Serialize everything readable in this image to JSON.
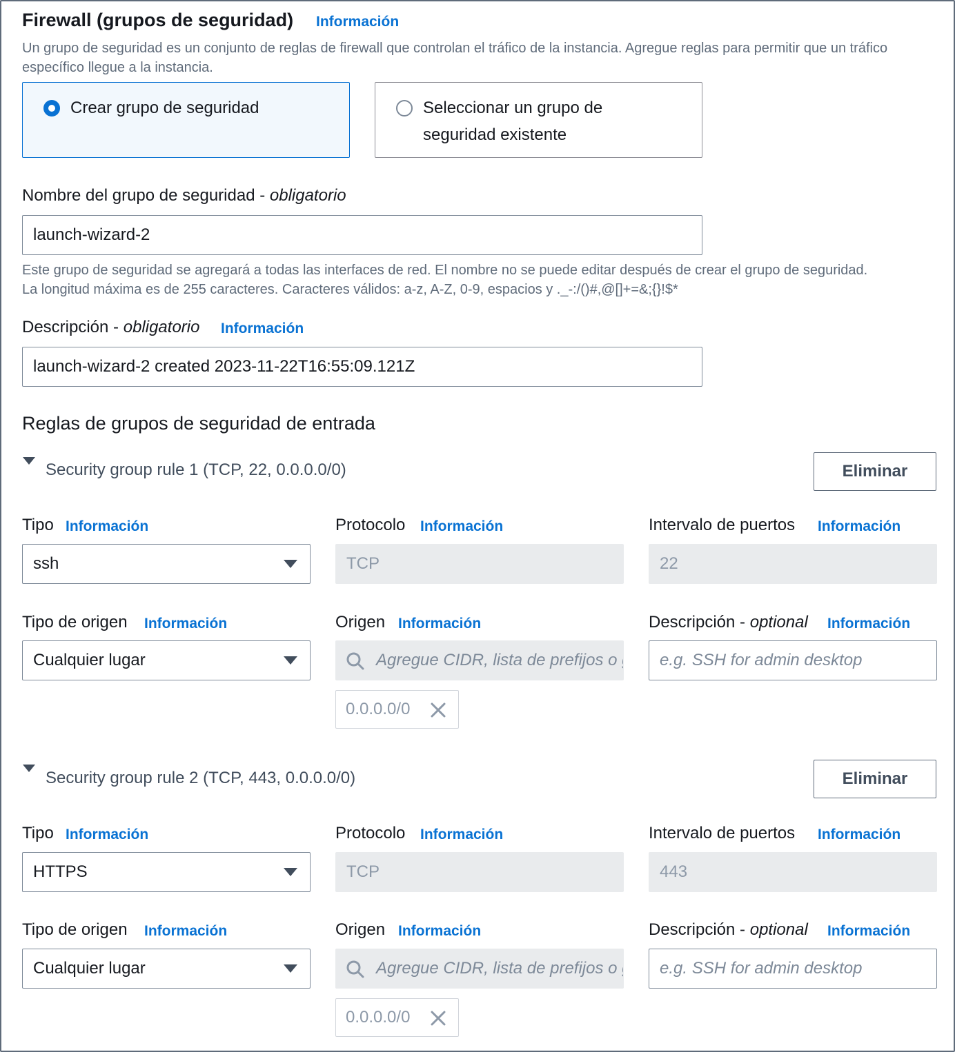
{
  "firewall": {
    "title": "Firewall (grupos de seguridad)",
    "info": "Información",
    "description": "Un grupo de seguridad es un conjunto de reglas de firewall que controlan el tráfico de la instancia. Agregue reglas para permitir que un tráfico específico llegue a la instancia.",
    "options": [
      {
        "label": "Crear grupo de seguridad",
        "selected": true
      },
      {
        "label_line1": "Seleccionar un grupo de",
        "label_line2": "seguridad existente",
        "selected": false
      }
    ]
  },
  "group_name": {
    "label": "Nombre del grupo de seguridad - ",
    "required": "obligatorio",
    "value": "launch-wizard-2",
    "help_line1": "Este grupo de seguridad se agregará a todas las interfaces de red. El nombre no se puede editar después de crear el grupo de seguridad.",
    "help_line2": "La longitud máxima es de 255 caracteres. Caracteres válidos: a-z, A-Z, 0-9, espacios y ._-:/()#,@[]+=&;{}!$*"
  },
  "group_description": {
    "label": "Descripción - ",
    "required": "obligatorio",
    "info": "Información",
    "value": "launch-wizard-2 created 2023-11-22T16:55:09.121Z"
  },
  "inbound": {
    "title": "Reglas de grupos de seguridad de entrada",
    "info_label": "Información",
    "delete_label": "Eliminar",
    "labels": {
      "type": "Tipo",
      "protocol": "Protocolo",
      "port_range": "Intervalo de puertos",
      "source_type": "Tipo de origen",
      "source": "Origen",
      "description": "Descripción - ",
      "description_optional": "optional"
    },
    "source_placeholder": "Agregue CIDR, lista de prefijos o grupo de seguridad",
    "description_placeholder": "e.g. SSH for admin desktop",
    "rules": [
      {
        "header": "Security group rule 1 (TCP, 22, 0.0.0.0/0)",
        "type": "ssh",
        "protocol": "TCP",
        "port_range": "22",
        "source_type": "Cualquier lugar",
        "source_token": "0.0.0.0/0"
      },
      {
        "header": "Security group rule 2 (TCP, 443, 0.0.0.0/0)",
        "type": "HTTPS",
        "protocol": "TCP",
        "port_range": "443",
        "source_type": "Cualquier lugar",
        "source_token": "0.0.0.0/0"
      }
    ]
  },
  "icons": {
    "expander": "caret-down-icon",
    "select": "caret-down-icon",
    "search": "search-icon",
    "remove": "close-icon"
  },
  "colors": {
    "link": "#0972d3",
    "selected_tile_bg": "#f2f8fd",
    "disabled_bg": "#e9ebed",
    "text": "#16191f",
    "muted": "#5f6b7a"
  }
}
